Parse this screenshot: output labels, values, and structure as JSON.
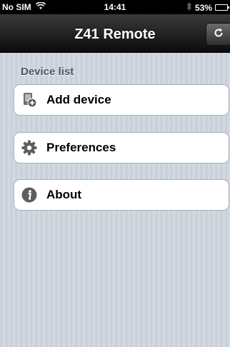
{
  "status_bar": {
    "carrier": "No SIM",
    "time": "14:41",
    "battery": "53%",
    "battery_level": 0.53
  },
  "nav": {
    "title": "Z41 Remote",
    "refresh_icon": "refresh-icon"
  },
  "list": {
    "header": "Device list",
    "items": [
      {
        "label": "Add device",
        "icon": "add-device-icon"
      },
      {
        "label": "Preferences",
        "icon": "gear-icon"
      },
      {
        "label": "About",
        "icon": "info-icon"
      }
    ]
  },
  "colors": {
    "nav_bar": "#1a1a1a",
    "background": "#d3d8e0",
    "section_header": "#4c566c"
  }
}
